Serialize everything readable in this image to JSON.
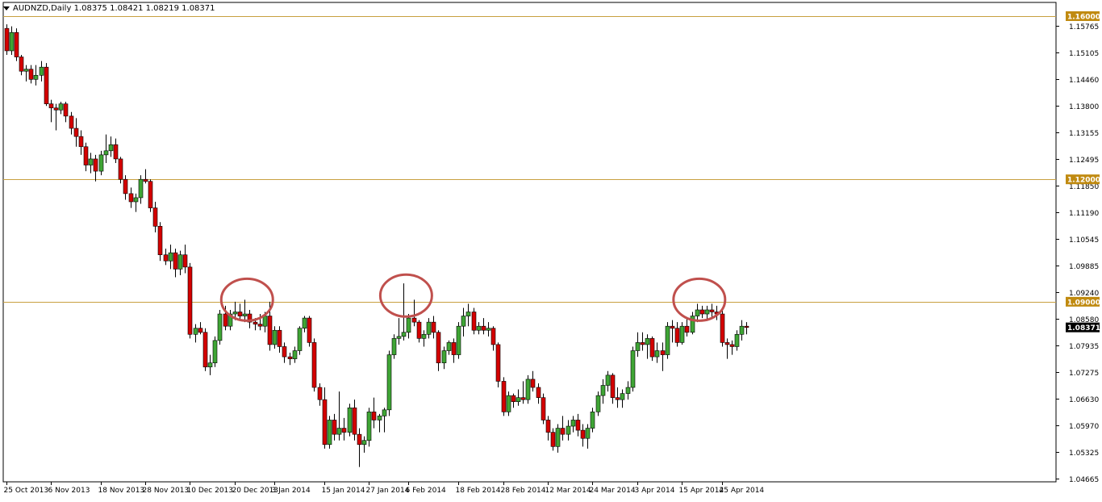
{
  "header": {
    "symbol_label": "AUDNZD,Daily",
    "ohlc": "1.08375 1.08421 1.08219 1.08371"
  },
  "colors": {
    "bull": "#3fa535",
    "bear": "#d40000",
    "wick": "#000000",
    "level_line": "#c8a040",
    "level_tag": "#c08a10",
    "circle": "#c0504d"
  },
  "chart_data": {
    "type": "candlestick",
    "title": "AUDNZD,Daily",
    "ylim": [
      1.04665,
      1.16
    ],
    "y_ticks": [
      "1.15765",
      "1.15105",
      "1.14460",
      "1.13800",
      "1.13155",
      "1.12495",
      "1.11850",
      "1.11190",
      "1.10545",
      "1.09885",
      "1.09240",
      "1.08580",
      "1.07935",
      "1.07275",
      "1.06630",
      "1.05970",
      "1.05325",
      "1.04665"
    ],
    "x_tick_labels": [
      "25 Oct 2013",
      "6 Nov 2013",
      "18 Nov 2013",
      "28 Nov 2013",
      "10 Dec 2013",
      "20 Dec 2013",
      "3 Jan 2014",
      "15 Jan 2014",
      "27 Jan 2014",
      "6 Feb 2014",
      "18 Feb 2014",
      "28 Feb 2014",
      "12 Mar 2014",
      "24 Mar 2014",
      "3 Apr 2014",
      "15 Apr 2014",
      "25 Apr 2014"
    ],
    "x_tick_bar_index": [
      0,
      9,
      19,
      28,
      37,
      46,
      54,
      64,
      73,
      81,
      91,
      100,
      109,
      118,
      127,
      136,
      144
    ],
    "horizontal_levels": [
      {
        "value": 1.16,
        "label": "1.16000"
      },
      {
        "value": 1.12,
        "label": "1.12000"
      },
      {
        "value": 1.09,
        "label": "1.09000"
      }
    ],
    "current_price": {
      "value": 1.08371,
      "label": "1.08371"
    },
    "annotations": [
      {
        "shape": "ellipse",
        "bar_index": 48.5,
        "price": 1.0905
      },
      {
        "shape": "ellipse",
        "bar_index": 80.5,
        "price": 1.0915
      },
      {
        "shape": "ellipse",
        "bar_index": 139.5,
        "price": 1.0905
      }
    ],
    "candles": [
      [
        1.157,
        1.158,
        1.1505,
        1.1515
      ],
      [
        1.1515,
        1.1575,
        1.1505,
        1.156
      ],
      [
        1.156,
        1.157,
        1.149,
        1.15
      ],
      [
        1.15,
        1.1505,
        1.1455,
        1.1465
      ],
      [
        1.1465,
        1.148,
        1.144,
        1.147
      ],
      [
        1.147,
        1.148,
        1.1435,
        1.1445
      ],
      [
        1.1445,
        1.148,
        1.143,
        1.1455
      ],
      [
        1.1455,
        1.149,
        1.144,
        1.1475
      ],
      [
        1.1475,
        1.1485,
        1.138,
        1.1385
      ],
      [
        1.1385,
        1.1395,
        1.134,
        1.1375
      ],
      [
        1.1375,
        1.1385,
        1.132,
        1.137
      ],
      [
        1.137,
        1.139,
        1.136,
        1.1385
      ],
      [
        1.1385,
        1.139,
        1.134,
        1.1355
      ],
      [
        1.1355,
        1.1365,
        1.131,
        1.1325
      ],
      [
        1.1325,
        1.135,
        1.128,
        1.1305
      ],
      [
        1.1305,
        1.132,
        1.126,
        1.128
      ],
      [
        1.128,
        1.129,
        1.122,
        1.1235
      ],
      [
        1.1235,
        1.1265,
        1.1215,
        1.125
      ],
      [
        1.125,
        1.126,
        1.1195,
        1.122
      ],
      [
        1.122,
        1.127,
        1.121,
        1.126
      ],
      [
        1.126,
        1.131,
        1.124,
        1.127
      ],
      [
        1.127,
        1.1305,
        1.1255,
        1.1285
      ],
      [
        1.1285,
        1.13,
        1.124,
        1.125
      ],
      [
        1.125,
        1.1255,
        1.119,
        1.12
      ],
      [
        1.12,
        1.121,
        1.115,
        1.1165
      ],
      [
        1.1165,
        1.118,
        1.113,
        1.1145
      ],
      [
        1.1145,
        1.1165,
        1.112,
        1.1155
      ],
      [
        1.1155,
        1.121,
        1.114,
        1.12
      ],
      [
        1.12,
        1.1225,
        1.119,
        1.1195
      ],
      [
        1.1195,
        1.12,
        1.112,
        1.113
      ],
      [
        1.113,
        1.1145,
        1.107,
        1.1085
      ],
      [
        1.1085,
        1.1095,
        1.1,
        1.1015
      ],
      [
        1.1015,
        1.103,
        1.099,
        1.1
      ],
      [
        1.1,
        1.104,
        1.098,
        1.102
      ],
      [
        1.102,
        1.103,
        1.096,
        1.098
      ],
      [
        1.098,
        1.1025,
        1.0965,
        1.1015
      ],
      [
        1.1015,
        1.104,
        1.097,
        1.0985
      ],
      [
        1.0985,
        1.0995,
        1.081,
        1.082
      ],
      [
        1.082,
        1.0845,
        1.08,
        1.0835
      ],
      [
        1.0835,
        1.085,
        1.082,
        1.0825
      ],
      [
        1.0825,
        1.0835,
        1.073,
        1.074
      ],
      [
        1.074,
        1.077,
        1.072,
        1.075
      ],
      [
        1.075,
        1.0815,
        1.074,
        1.0805
      ],
      [
        1.0805,
        1.088,
        1.0795,
        1.087
      ],
      [
        1.087,
        1.089,
        1.083,
        1.084
      ],
      [
        1.084,
        1.088,
        1.083,
        1.087
      ],
      [
        1.087,
        1.09,
        1.0855,
        1.0875
      ],
      [
        1.0875,
        1.0895,
        1.0855,
        1.0865
      ],
      [
        1.0865,
        1.0905,
        1.085,
        1.087
      ],
      [
        1.087,
        1.088,
        1.0835,
        1.085
      ],
      [
        1.085,
        1.086,
        1.083,
        1.0845
      ],
      [
        1.0845,
        1.087,
        1.083,
        1.084
      ],
      [
        1.084,
        1.0875,
        1.0825,
        1.0865
      ],
      [
        1.0865,
        1.09,
        1.078,
        1.0795
      ],
      [
        1.0795,
        1.084,
        1.0785,
        1.083
      ],
      [
        1.083,
        1.084,
        1.0775,
        1.079
      ],
      [
        1.079,
        1.08,
        1.075,
        1.0765
      ],
      [
        1.0765,
        1.0775,
        1.0745,
        1.076
      ],
      [
        1.076,
        1.079,
        1.075,
        1.078
      ],
      [
        1.078,
        1.084,
        1.077,
        1.0835
      ],
      [
        1.0835,
        1.0865,
        1.0825,
        1.086
      ],
      [
        1.086,
        1.0865,
        1.079,
        1.08
      ],
      [
        1.08,
        1.081,
        1.068,
        1.069
      ],
      [
        1.069,
        1.07,
        1.0645,
        1.066
      ],
      [
        1.066,
        1.069,
        1.054,
        1.055
      ],
      [
        1.055,
        1.062,
        1.054,
        1.061
      ],
      [
        1.061,
        1.0625,
        1.056,
        1.0575
      ],
      [
        1.0575,
        1.068,
        1.056,
        1.059
      ],
      [
        1.059,
        1.0615,
        1.056,
        1.058
      ],
      [
        1.058,
        1.065,
        1.057,
        1.064
      ],
      [
        1.064,
        1.066,
        1.056,
        1.0575
      ],
      [
        1.0575,
        1.059,
        1.0495,
        1.055
      ],
      [
        1.055,
        1.057,
        1.053,
        1.056
      ],
      [
        1.056,
        1.064,
        1.0545,
        1.063
      ],
      [
        1.063,
        1.0665,
        1.059,
        1.061
      ],
      [
        1.061,
        1.0625,
        1.058,
        1.062
      ],
      [
        1.062,
        1.064,
        1.058,
        1.0635
      ],
      [
        1.0635,
        1.078,
        1.062,
        1.077
      ],
      [
        1.077,
        1.082,
        1.076,
        1.081
      ],
      [
        1.081,
        1.086,
        1.0795,
        1.0815
      ],
      [
        1.0815,
        1.0945,
        1.0805,
        1.0825
      ],
      [
        1.0825,
        1.087,
        1.081,
        1.086
      ],
      [
        1.086,
        1.0905,
        1.084,
        1.085
      ],
      [
        1.085,
        1.0855,
        1.08,
        1.081
      ],
      [
        1.081,
        1.083,
        1.079,
        1.082
      ],
      [
        1.082,
        1.086,
        1.081,
        1.085
      ],
      [
        1.085,
        1.0865,
        1.081,
        1.0825
      ],
      [
        1.0825,
        1.083,
        1.073,
        1.075
      ],
      [
        1.075,
        1.079,
        1.0735,
        1.078
      ],
      [
        1.078,
        1.0805,
        1.077,
        1.08
      ],
      [
        1.08,
        1.081,
        1.075,
        1.077
      ],
      [
        1.077,
        1.085,
        1.076,
        1.084
      ],
      [
        1.084,
        1.0885,
        1.0815,
        1.0865
      ],
      [
        1.0865,
        1.0895,
        1.084,
        1.0875
      ],
      [
        1.0875,
        1.0885,
        1.082,
        1.083
      ],
      [
        1.083,
        1.085,
        1.082,
        1.084
      ],
      [
        1.084,
        1.086,
        1.082,
        1.083
      ],
      [
        1.083,
        1.085,
        1.0815,
        1.0835
      ],
      [
        1.0835,
        1.084,
        1.078,
        1.0795
      ],
      [
        1.0795,
        1.08,
        1.069,
        1.0705
      ],
      [
        1.0705,
        1.0715,
        1.062,
        1.063
      ],
      [
        1.063,
        1.068,
        1.062,
        1.067
      ],
      [
        1.067,
        1.0675,
        1.064,
        1.0655
      ],
      [
        1.0655,
        1.0685,
        1.0645,
        1.0665
      ],
      [
        1.0665,
        1.0705,
        1.065,
        1.066
      ],
      [
        1.066,
        1.072,
        1.065,
        1.071
      ],
      [
        1.071,
        1.073,
        1.068,
        1.069
      ],
      [
        1.069,
        1.07,
        1.065,
        1.0665
      ],
      [
        1.0665,
        1.0675,
        1.06,
        1.061
      ],
      [
        1.061,
        1.062,
        1.056,
        1.058
      ],
      [
        1.058,
        1.059,
        1.0535,
        1.0545
      ],
      [
        1.0545,
        1.06,
        1.053,
        1.059
      ],
      [
        1.059,
        1.062,
        1.056,
        1.0575
      ],
      [
        1.0575,
        1.061,
        1.056,
        1.0595
      ],
      [
        1.0595,
        1.062,
        1.058,
        1.061
      ],
      [
        1.061,
        1.0625,
        1.057,
        1.0585
      ],
      [
        1.0585,
        1.06,
        1.0545,
        1.0565
      ],
      [
        1.0565,
        1.06,
        1.054,
        1.059
      ],
      [
        1.059,
        1.064,
        1.058,
        1.063
      ],
      [
        1.063,
        1.068,
        1.062,
        1.067
      ],
      [
        1.067,
        1.071,
        1.065,
        1.0695
      ],
      [
        1.0695,
        1.073,
        1.068,
        1.072
      ],
      [
        1.072,
        1.0725,
        1.065,
        1.0665
      ],
      [
        1.0665,
        1.069,
        1.064,
        1.066
      ],
      [
        1.066,
        1.0685,
        1.064,
        1.0675
      ],
      [
        1.0675,
        1.0705,
        1.066,
        1.069
      ],
      [
        1.069,
        1.079,
        1.068,
        1.078
      ],
      [
        1.078,
        1.0825,
        1.0765,
        1.08
      ],
      [
        1.08,
        1.0825,
        1.078,
        1.0795
      ],
      [
        1.0795,
        1.082,
        1.076,
        1.081
      ],
      [
        1.081,
        1.0815,
        1.0755,
        1.0765
      ],
      [
        1.0765,
        1.08,
        1.075,
        1.078
      ],
      [
        1.078,
        1.08,
        1.073,
        1.077
      ],
      [
        1.077,
        1.085,
        1.076,
        1.084
      ],
      [
        1.084,
        1.0855,
        1.08,
        1.0835
      ],
      [
        1.0835,
        1.085,
        1.079,
        1.08
      ],
      [
        1.08,
        1.085,
        1.0795,
        1.084
      ],
      [
        1.084,
        1.086,
        1.0815,
        1.0825
      ],
      [
        1.0825,
        1.0875,
        1.082,
        1.0865
      ],
      [
        1.0865,
        1.0895,
        1.085,
        1.088
      ],
      [
        1.088,
        1.089,
        1.086,
        1.087
      ],
      [
        1.087,
        1.089,
        1.0855,
        1.088
      ],
      [
        1.088,
        1.0895,
        1.086,
        1.0875
      ],
      [
        1.0875,
        1.089,
        1.0855,
        1.087
      ],
      [
        1.087,
        1.088,
        1.079,
        1.08
      ],
      [
        1.08,
        1.081,
        1.076,
        1.0795
      ],
      [
        1.0795,
        1.0805,
        1.077,
        1.079
      ],
      [
        1.079,
        1.083,
        1.078,
        1.082
      ],
      [
        1.082,
        1.0855,
        1.0805,
        1.084
      ],
      [
        1.084,
        1.085,
        1.082,
        1.0837
      ]
    ]
  }
}
